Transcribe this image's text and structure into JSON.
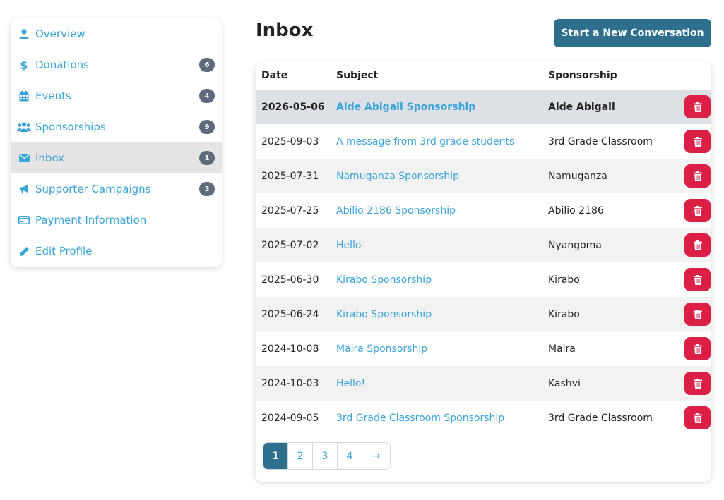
{
  "sidebar": {
    "items": [
      {
        "label": "Overview",
        "icon": "user-icon",
        "badge": null
      },
      {
        "label": "Donations",
        "icon": "dollar-icon",
        "badge": "6"
      },
      {
        "label": "Events",
        "icon": "calendar-icon",
        "badge": "4"
      },
      {
        "label": "Sponsorships",
        "icon": "users-icon",
        "badge": "9"
      },
      {
        "label": "Inbox",
        "icon": "envelope-icon",
        "badge": "1"
      },
      {
        "label": "Supporter Campaigns",
        "icon": "megaphone-icon",
        "badge": "3"
      },
      {
        "label": "Payment Information",
        "icon": "credit-card-icon",
        "badge": null
      },
      {
        "label": "Edit Profile",
        "icon": "pencil-icon",
        "badge": null
      }
    ]
  },
  "page": {
    "title": "Inbox",
    "new_conversation_label": "Start a New Conversation"
  },
  "table": {
    "headers": {
      "date": "Date",
      "subject": "Subject",
      "sponsorship": "Sponsorship"
    },
    "rows": [
      {
        "date": "2026-05-06",
        "subject": "Aide Abigail Sponsorship",
        "sponsorship": "Aide Abigail"
      },
      {
        "date": "2025-09-03",
        "subject": "A message from 3rd grade students",
        "sponsorship": "3rd Grade Classroom"
      },
      {
        "date": "2025-07-31",
        "subject": "Namuganza Sponsorship",
        "sponsorship": "Namuganza"
      },
      {
        "date": "2025-07-25",
        "subject": "Abilio 2186 Sponsorship",
        "sponsorship": "Abilio 2186"
      },
      {
        "date": "2025-07-02",
        "subject": "Hello",
        "sponsorship": "Nyangoma"
      },
      {
        "date": "2025-06-30",
        "subject": "Kirabo Sponsorship",
        "sponsorship": "Kirabo"
      },
      {
        "date": "2025-06-24",
        "subject": "Kirabo Sponsorship",
        "sponsorship": "Kirabo"
      },
      {
        "date": "2024-10-08",
        "subject": "Maira Sponsorship",
        "sponsorship": "Maira"
      },
      {
        "date": "2024-10-03",
        "subject": "Hello!",
        "sponsorship": "Kashvi"
      },
      {
        "date": "2024-09-05",
        "subject": "3rd Grade Classroom Sponsorship",
        "sponsorship": "3rd Grade Classroom"
      }
    ]
  },
  "pagination": {
    "pages": [
      "1",
      "2",
      "3",
      "4"
    ],
    "next": "→",
    "current": "1"
  },
  "colors": {
    "link": "#3aa3d8",
    "primary": "#2e6f8e",
    "danger": "#dc1f45",
    "badge": "#5f6b7a"
  }
}
